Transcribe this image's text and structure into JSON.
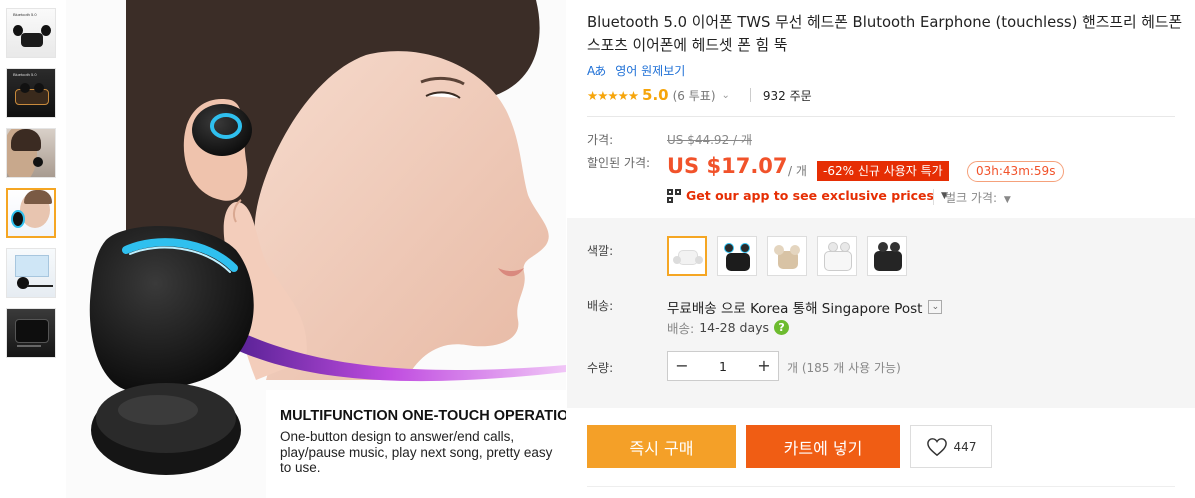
{
  "thumbnails": [
    {
      "label": "Bluetooth 5.0"
    },
    {
      "label": "Bluetooth 5.0"
    },
    {
      "label": ""
    },
    {
      "label": ""
    },
    {
      "label": ""
    },
    {
      "label": ""
    }
  ],
  "main_image": {
    "headline": "MULTIFUNCTION ONE-TOUCH OPERATION",
    "description": "One-button design to answer/end calls, play/pause music, play next song, pretty easy to use.",
    "colors": {
      "accent_ring": "#2fc0ef",
      "purple_swoosh": "#8d3fd1"
    }
  },
  "product": {
    "title": "Bluetooth 5.0 이어폰 TWS 무선 헤드폰 Blutooth Earphone (touchless) 핸즈프리 헤드폰 스포츠 이어폰에 헤드셋 폰 힘 뚝",
    "translate_icon": "Aあ",
    "translate_label": "영어 원제보기",
    "stars": "★★★★★",
    "score": "5.0",
    "votes": "(6 투표)",
    "orders": "932 주문"
  },
  "pricing": {
    "price_label": "가격:",
    "original_price": "US $44.92 / 개",
    "discount_label": "할인된 가격:",
    "sale_price": "US $17.07",
    "unit": "/ 개",
    "badge": "-62% 신규 사용자 특가",
    "timer": "03h:43m:59s",
    "app_link": "Get our app to see exclusive prices",
    "bulk_price": "벌크 가격:"
  },
  "options": {
    "color_label": "색깔:",
    "colors": [
      {
        "name": "white-selected",
        "case": "#f2f2f2",
        "bud": "#dcdcdc"
      },
      {
        "name": "black-blue",
        "case": "#1c1c1c",
        "bud": "#2a2a2a"
      },
      {
        "name": "beige",
        "case": "#d8c3a5",
        "bud": "#e4d5bf"
      },
      {
        "name": "white",
        "case": "#f7f7f7",
        "bud": "#e8e8e8"
      },
      {
        "name": "black",
        "case": "#252525",
        "bud": "#333333"
      }
    ],
    "shipping_label": "배송:",
    "shipping_main": "무료배송 으로 Korea 통해 Singapore Post",
    "shipping_sub_label": "배송:",
    "shipping_sub_value": "14-28 days",
    "qty_label": "수량:",
    "qty_value": "1",
    "qty_available": "개 (185 개 사용 가능)"
  },
  "actions": {
    "buy_now": "즉시 구매",
    "add_to_cart": "카트에 넣기",
    "wishlist_count": "447"
  }
}
